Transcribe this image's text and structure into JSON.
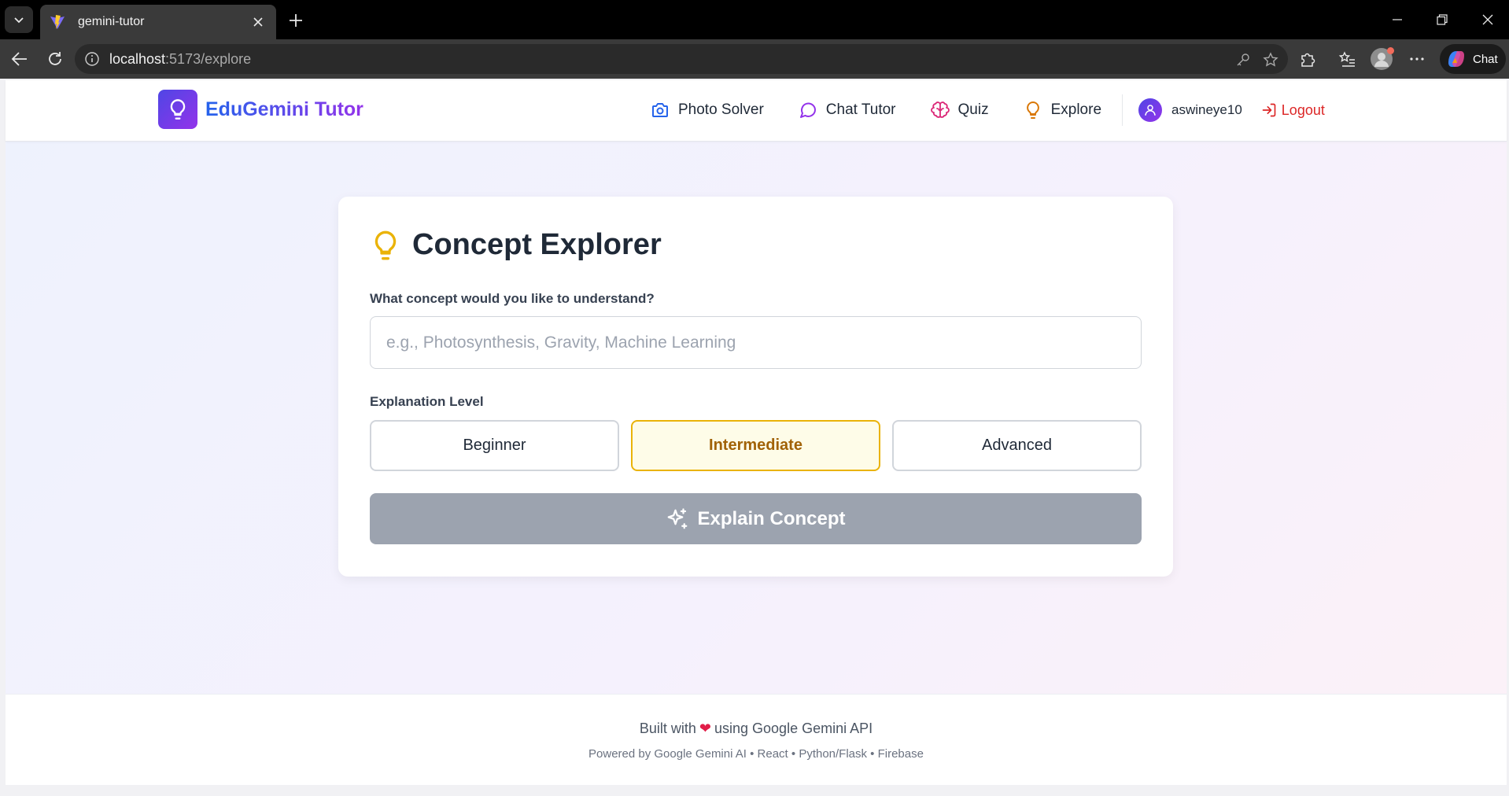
{
  "browser": {
    "tab_title": "gemini-tutor",
    "url_host": "localhost",
    "url_path": ":5173/explore",
    "copilot_label": "Chat"
  },
  "header": {
    "brand": "EduGemini Tutor",
    "nav": [
      {
        "label": "Photo Solver",
        "icon": "camera-icon",
        "color": "#2563eb"
      },
      {
        "label": "Chat Tutor",
        "icon": "chat-bubble-icon",
        "color": "#9333ea"
      },
      {
        "label": "Quiz",
        "icon": "brain-icon",
        "color": "#db2777"
      },
      {
        "label": "Explore",
        "icon": "lightbulb-icon",
        "color": "#d97706"
      }
    ],
    "username": "aswineye10",
    "logout_label": "Logout"
  },
  "explorer": {
    "title": "Concept Explorer",
    "question_label": "What concept would you like to understand?",
    "input_value": "",
    "input_placeholder": "e.g., Photosynthesis, Gravity, Machine Learning",
    "level_label": "Explanation Level",
    "levels": [
      "Beginner",
      "Intermediate",
      "Advanced"
    ],
    "selected_level": "Intermediate",
    "submit_label": "Explain Concept"
  },
  "footer": {
    "built_prefix": "Built with",
    "built_suffix": "using Google Gemini API",
    "heart": "❤",
    "powered_by": "Powered by Google Gemini AI • React • Python/Flask • Firebase"
  },
  "colors": {
    "accent_gradient": [
      "#4f46e5",
      "#9333ea"
    ],
    "selected_level_border": "#eab308",
    "logout": "#dc2626",
    "disabled_button": "#9ca3af"
  }
}
